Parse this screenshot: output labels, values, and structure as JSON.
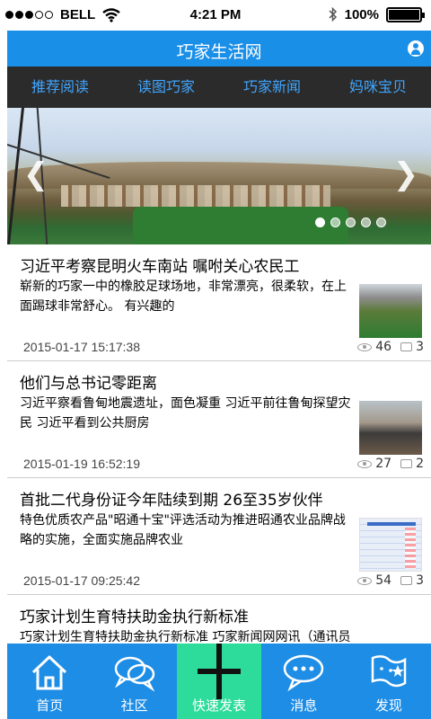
{
  "status": {
    "carrier": "BELL",
    "time": "4:21 PM",
    "battery": "100%",
    "battery_level": 1.0
  },
  "header": {
    "title": "巧家生活网"
  },
  "tabs": [
    "推荐阅读",
    "读图巧家",
    "巧家新闻",
    "妈咪宝贝"
  ],
  "carousel": {
    "slides": 5,
    "active": 0
  },
  "news": [
    {
      "headline": "习近平考察昆明火车南站 嘱咐关心农民工",
      "summary": "崭新的巧家一中的橡胶足球场地，非常漂亮，很柔软，在上面踢球非常舒心。 有兴趣的",
      "date": "2015-01-17 15:17:38",
      "views": "46",
      "comments": "3"
    },
    {
      "headline": "他们与总书记零距离",
      "summary": "习近平察看鲁甸地震遗址，面色凝重 习近平前往鲁甸探望灾民 习近平看到公共厨房",
      "date": "2015-01-19 16:52:19",
      "views": "27",
      "comments": "2"
    },
    {
      "headline": "首批二代身份证今年陆续到期 26至35岁伙伴",
      "summary": "特色优质农产品\"昭通十宝\"评选活动为推进昭通农业品牌战略的实施，全面实施品牌农业",
      "date": "2015-01-17 09:25:42",
      "views": "54",
      "comments": "3"
    },
    {
      "headline": "巧家计划生育特扶助金执行新标准",
      "summary": "巧家计划生育特扶助金执行新标准 巧家新闻网网讯（通讯员"
    }
  ],
  "bottom_nav": [
    {
      "label": "首页",
      "icon": "home-icon"
    },
    {
      "label": "社区",
      "icon": "chat-bubbles-icon"
    },
    {
      "label": "快速发表",
      "icon": "plus-icon"
    },
    {
      "label": "消息",
      "icon": "message-icon"
    },
    {
      "label": "发现",
      "icon": "flag-icon"
    }
  ]
}
